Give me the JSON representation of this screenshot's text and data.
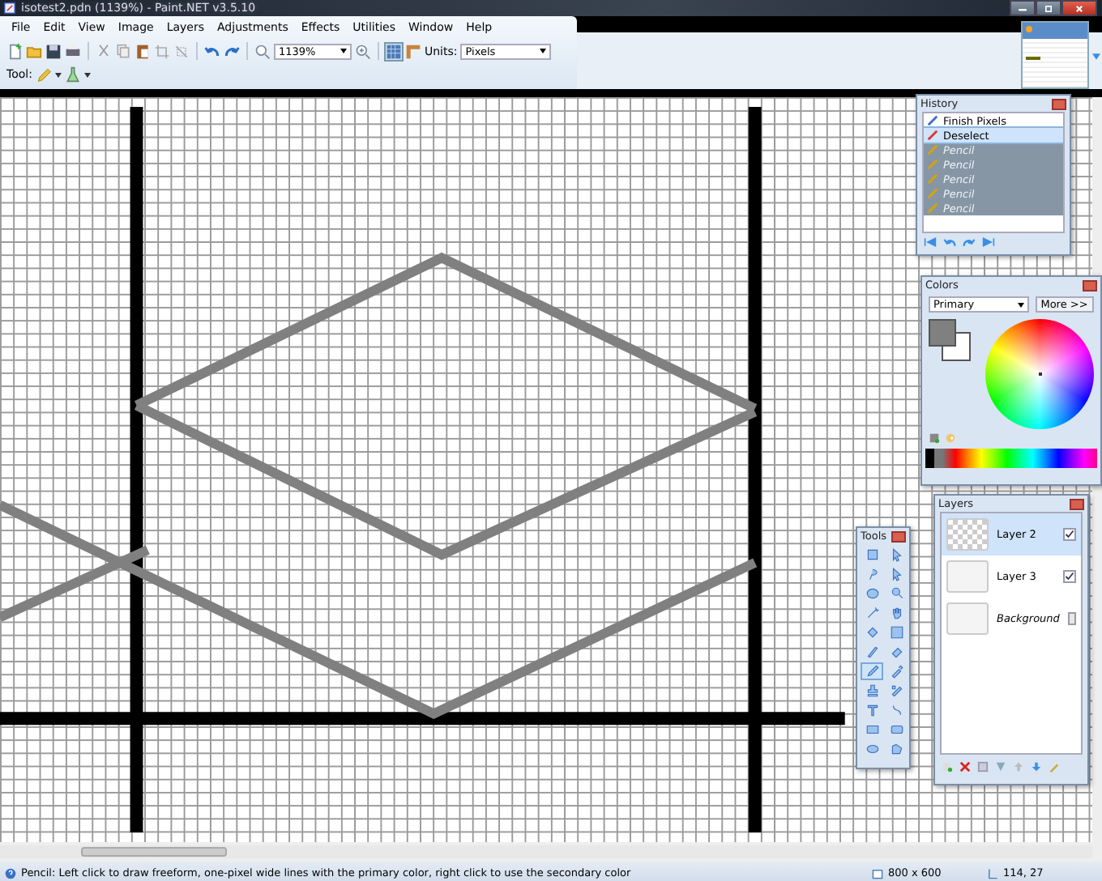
{
  "window": {
    "title": "isotest2.pdn (1139%) - Paint.NET v3.5.10"
  },
  "menu": [
    "File",
    "Edit",
    "View",
    "Image",
    "Layers",
    "Adjustments",
    "Effects",
    "Utilities",
    "Window",
    "Help"
  ],
  "toolbar": {
    "zoom": "1139%",
    "units_label": "Units:",
    "units": "Pixels",
    "tool_label": "Tool:"
  },
  "history": {
    "title": "History",
    "items": [
      {
        "label": "Finish Pixels",
        "kind": "arrow",
        "undone": false,
        "selected": false
      },
      {
        "label": "Deselect",
        "kind": "deselect",
        "undone": false,
        "selected": true
      },
      {
        "label": "Pencil",
        "kind": "pencil",
        "undone": true,
        "selected": false
      },
      {
        "label": "Pencil",
        "kind": "pencil",
        "undone": true,
        "selected": false
      },
      {
        "label": "Pencil",
        "kind": "pencil",
        "undone": true,
        "selected": false
      },
      {
        "label": "Pencil",
        "kind": "pencil",
        "undone": true,
        "selected": false
      },
      {
        "label": "Pencil",
        "kind": "pencil",
        "undone": true,
        "selected": false
      }
    ]
  },
  "colors": {
    "title": "Colors",
    "mode": "Primary",
    "more": "More >>"
  },
  "tools": {
    "title": "Tools",
    "items": [
      {
        "kind": "rect-select",
        "selected": false
      },
      {
        "kind": "move",
        "selected": false
      },
      {
        "kind": "lasso",
        "selected": false
      },
      {
        "kind": "move",
        "selected": false
      },
      {
        "kind": "ellipse-select",
        "selected": false
      },
      {
        "kind": "zoom",
        "selected": false
      },
      {
        "kind": "wand",
        "selected": false
      },
      {
        "kind": "hand",
        "selected": false
      },
      {
        "kind": "bucket",
        "selected": false
      },
      {
        "kind": "gradient",
        "selected": false
      },
      {
        "kind": "brush",
        "selected": false
      },
      {
        "kind": "eraser",
        "selected": false
      },
      {
        "kind": "pencil",
        "selected": true
      },
      {
        "kind": "picker",
        "selected": false
      },
      {
        "kind": "stamp",
        "selected": false
      },
      {
        "kind": "recolor",
        "selected": false
      },
      {
        "kind": "text",
        "selected": false
      },
      {
        "kind": "line",
        "selected": false
      },
      {
        "kind": "rect",
        "selected": false
      },
      {
        "kind": "rounded-rect",
        "selected": false
      },
      {
        "kind": "ellipse",
        "selected": false
      },
      {
        "kind": "freeform",
        "selected": false
      }
    ]
  },
  "layers": {
    "title": "Layers",
    "items": [
      {
        "name": "Layer 2",
        "selected": true,
        "visible": true
      },
      {
        "name": "Layer 3",
        "selected": false,
        "visible": true
      },
      {
        "name": "Background",
        "selected": false,
        "visible": false
      }
    ]
  },
  "status_bar": {
    "hint": "Pencil: Left click to draw freeform, one-pixel wide lines with the primary color, right click to use the secondary color",
    "size": "800 x 600",
    "position": "114, 27"
  }
}
